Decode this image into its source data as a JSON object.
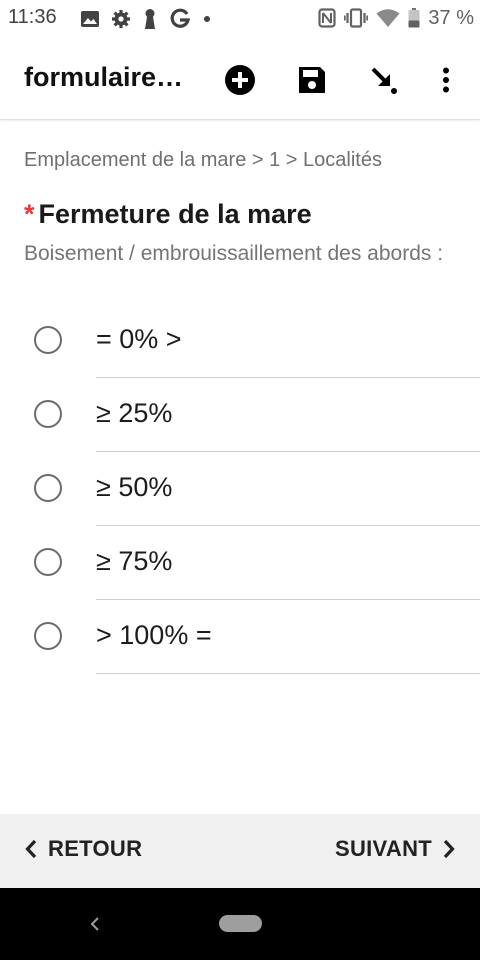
{
  "status_bar": {
    "time": "11:36",
    "battery_text": "37 %",
    "left_icons": [
      "image-icon",
      "gear-icon",
      "keyhole-icon",
      "google-g-icon",
      "dot-icon"
    ],
    "right_icons": [
      "nfc-icon",
      "vibrate-icon",
      "wifi-icon",
      "battery-icon"
    ]
  },
  "app_bar": {
    "title": "formulaire…",
    "actions": [
      "add-icon",
      "save-icon",
      "arrow-down-right-icon",
      "more-vert-icon"
    ]
  },
  "breadcrumb": "Emplacement de la mare > 1 > Localités",
  "question": {
    "required_mark": "*",
    "label": "Fermeture de la mare",
    "hint": "Boisement / embrouissaillement des abords :"
  },
  "options": [
    {
      "label": "= 0% >",
      "selected": false
    },
    {
      "label": "≥ 25%",
      "selected": false
    },
    {
      "label": "≥ 50%",
      "selected": false
    },
    {
      "label": "≥ 75%",
      "selected": false
    },
    {
      "label": "> 100% =",
      "selected": false
    }
  ],
  "bottom_nav": {
    "back_label": "RETOUR",
    "next_label": "SUIVANT"
  },
  "colors": {
    "required": "#e53935",
    "bottom_bar": "#f0f0f0",
    "system_nav": "#000000"
  }
}
